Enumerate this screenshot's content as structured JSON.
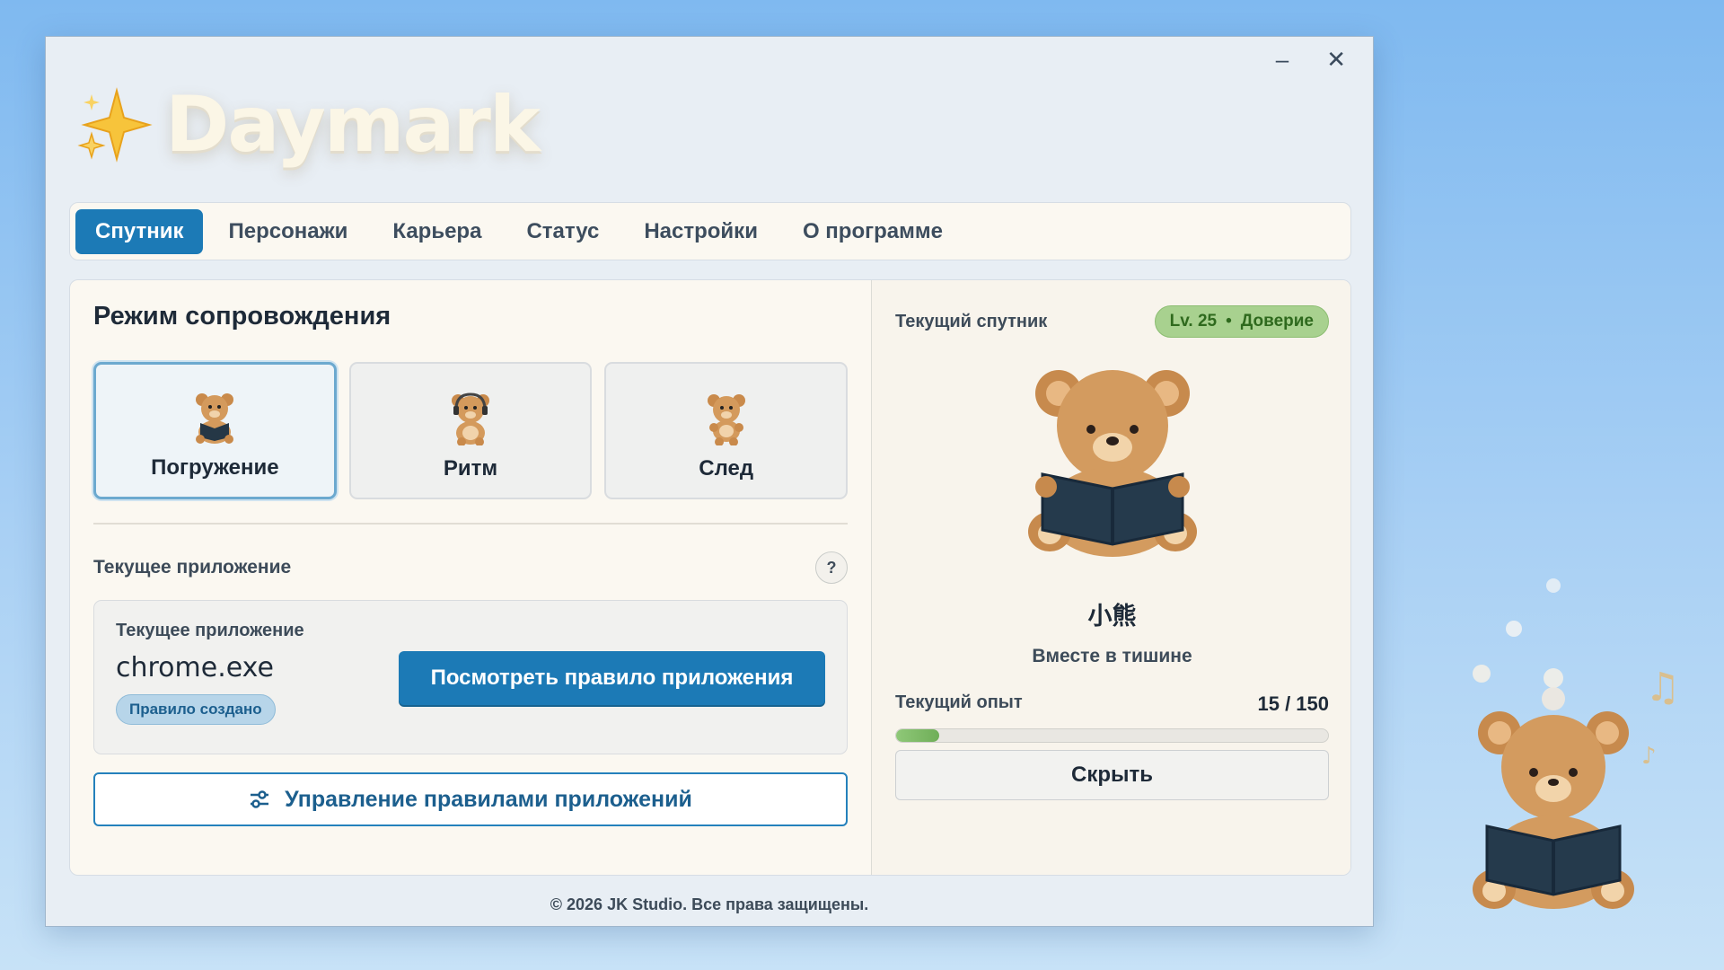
{
  "window": {
    "minimize_glyph": "–",
    "close_glyph": "✕"
  },
  "logo": {
    "text": "Daymark",
    "icon": "sparkle-icon"
  },
  "tabs": [
    {
      "label": "Спутник",
      "active": true
    },
    {
      "label": "Персонажи",
      "active": false
    },
    {
      "label": "Карьера",
      "active": false
    },
    {
      "label": "Статус",
      "active": false
    },
    {
      "label": "Настройки",
      "active": false
    },
    {
      "label": "О программе",
      "active": false
    }
  ],
  "mode_section": {
    "title": "Режим сопровождения",
    "modes": [
      {
        "label": "Погружение",
        "icon": "bear-reading-icon",
        "selected": true
      },
      {
        "label": "Ритм",
        "icon": "bear-headphones-icon",
        "selected": false
      },
      {
        "label": "След",
        "icon": "bear-walking-icon",
        "selected": false
      }
    ]
  },
  "app_section": {
    "row_label": "Текущее приложение",
    "help_glyph": "?",
    "card_label": "Текущее приложение",
    "app_name": "chrome.exe",
    "badge": "Правило создано",
    "view_rule_button": "Посмотреть правило приложения",
    "manage_button": "Управление правилами приложений"
  },
  "companion": {
    "label": "Текущий спутник",
    "level": "Lv. 25",
    "level_sep": "•",
    "trust": "Доверие",
    "name": "小熊",
    "subtitle": "Вместе в тишине",
    "exp_label": "Текущий опыт",
    "exp_value": "15 / 150",
    "exp_fraction": 0.1,
    "hide_button": "Скрыть"
  },
  "footer": "© 2026 JK Studio. Все права защищены.",
  "colors": {
    "accent": "#1c7ab6",
    "level_badge": "#a8d18f",
    "background": "#8fc2f2"
  }
}
